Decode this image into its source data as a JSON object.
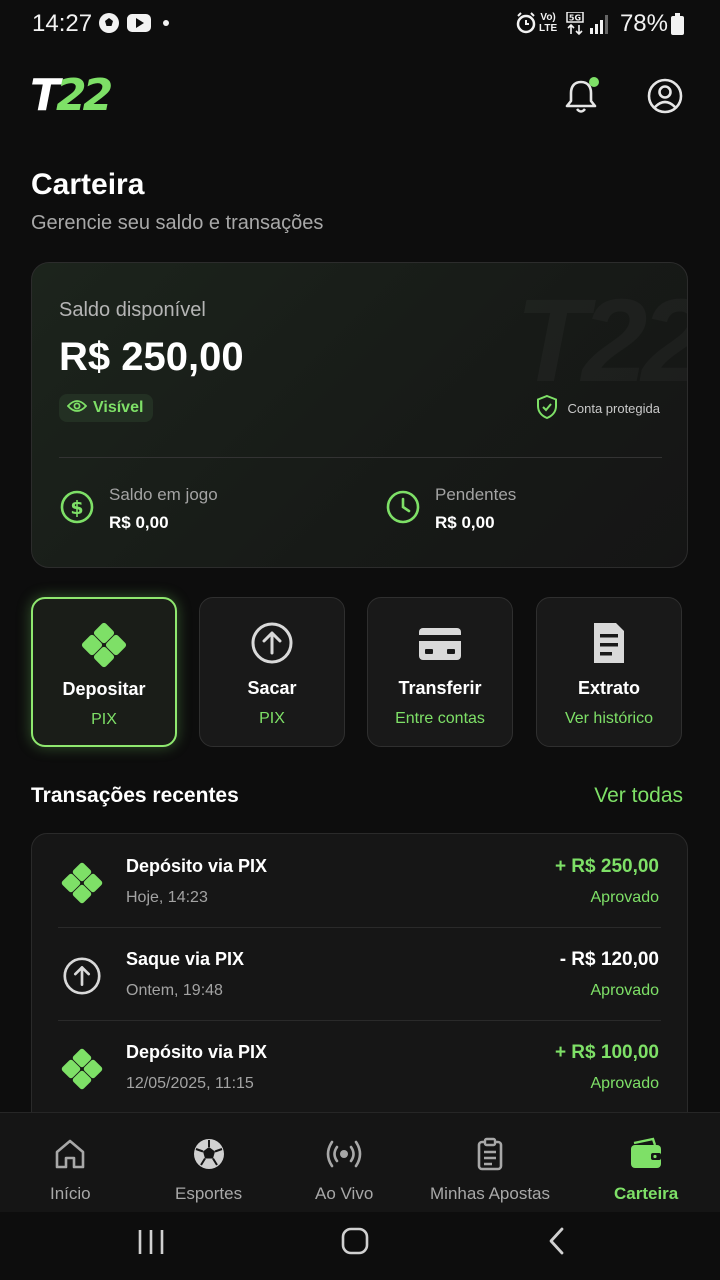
{
  "status_bar": {
    "time": "14:27",
    "battery": "78%",
    "network": "LTE"
  },
  "header": {
    "logo_text": "T22"
  },
  "page": {
    "title": "Carteira",
    "subtitle": "Gerencie seu saldo e transações"
  },
  "balance_card": {
    "label": "Saldo disponível",
    "value": "R$ 250,00",
    "visibility_label": "Visível",
    "protected_label": "Conta protegida",
    "in_play_label": "Saldo em jogo",
    "in_play_value": "R$ 0,00",
    "pending_label": "Pendentes",
    "pending_value": "R$ 0,00",
    "watermark": "T22"
  },
  "actions": [
    {
      "title": "Depositar",
      "subtitle": "PIX",
      "icon": "pix-icon",
      "active": true
    },
    {
      "title": "Sacar",
      "subtitle": "PIX",
      "icon": "arrow-up-circle-icon",
      "active": false
    },
    {
      "title": "Transferir",
      "subtitle": "Entre contas",
      "icon": "card-icon",
      "active": false
    },
    {
      "title": "Extrato",
      "subtitle": "Ver histórico",
      "icon": "document-icon",
      "active": false
    }
  ],
  "transactions": {
    "heading": "Transações recentes",
    "view_all": "Ver todas",
    "items": [
      {
        "title": "Depósito via PIX",
        "date": "Hoje, 14:23",
        "amount": "+ R$ 250,00",
        "status": "Aprovado",
        "icon": "pix-icon",
        "amount_color": "#7ee067"
      },
      {
        "title": "Saque via PIX",
        "date": "Ontem, 19:48",
        "amount": "- R$ 120,00",
        "status": "Aprovado",
        "icon": "arrow-up-circle-icon",
        "amount_color": "#ffffff"
      },
      {
        "title": "Depósito via PIX",
        "date": "12/05/2025, 11:15",
        "amount": "+ R$ 100,00",
        "status": "Aprovado",
        "icon": "pix-icon",
        "amount_color": "#7ee067"
      }
    ]
  },
  "bottom_nav": [
    {
      "label": "Início",
      "icon": "home-icon",
      "active": false
    },
    {
      "label": "Esportes",
      "icon": "soccer-ball-icon",
      "active": false
    },
    {
      "label": "Ao Vivo",
      "icon": "live-broadcast-icon",
      "active": false
    },
    {
      "label": "Minhas Apostas",
      "icon": "clipboard-icon",
      "active": false
    },
    {
      "label": "Carteira",
      "icon": "wallet-icon",
      "active": true
    }
  ],
  "colors": {
    "accent": "#7ee067",
    "background": "#0d0d0d",
    "card": "#161616"
  }
}
